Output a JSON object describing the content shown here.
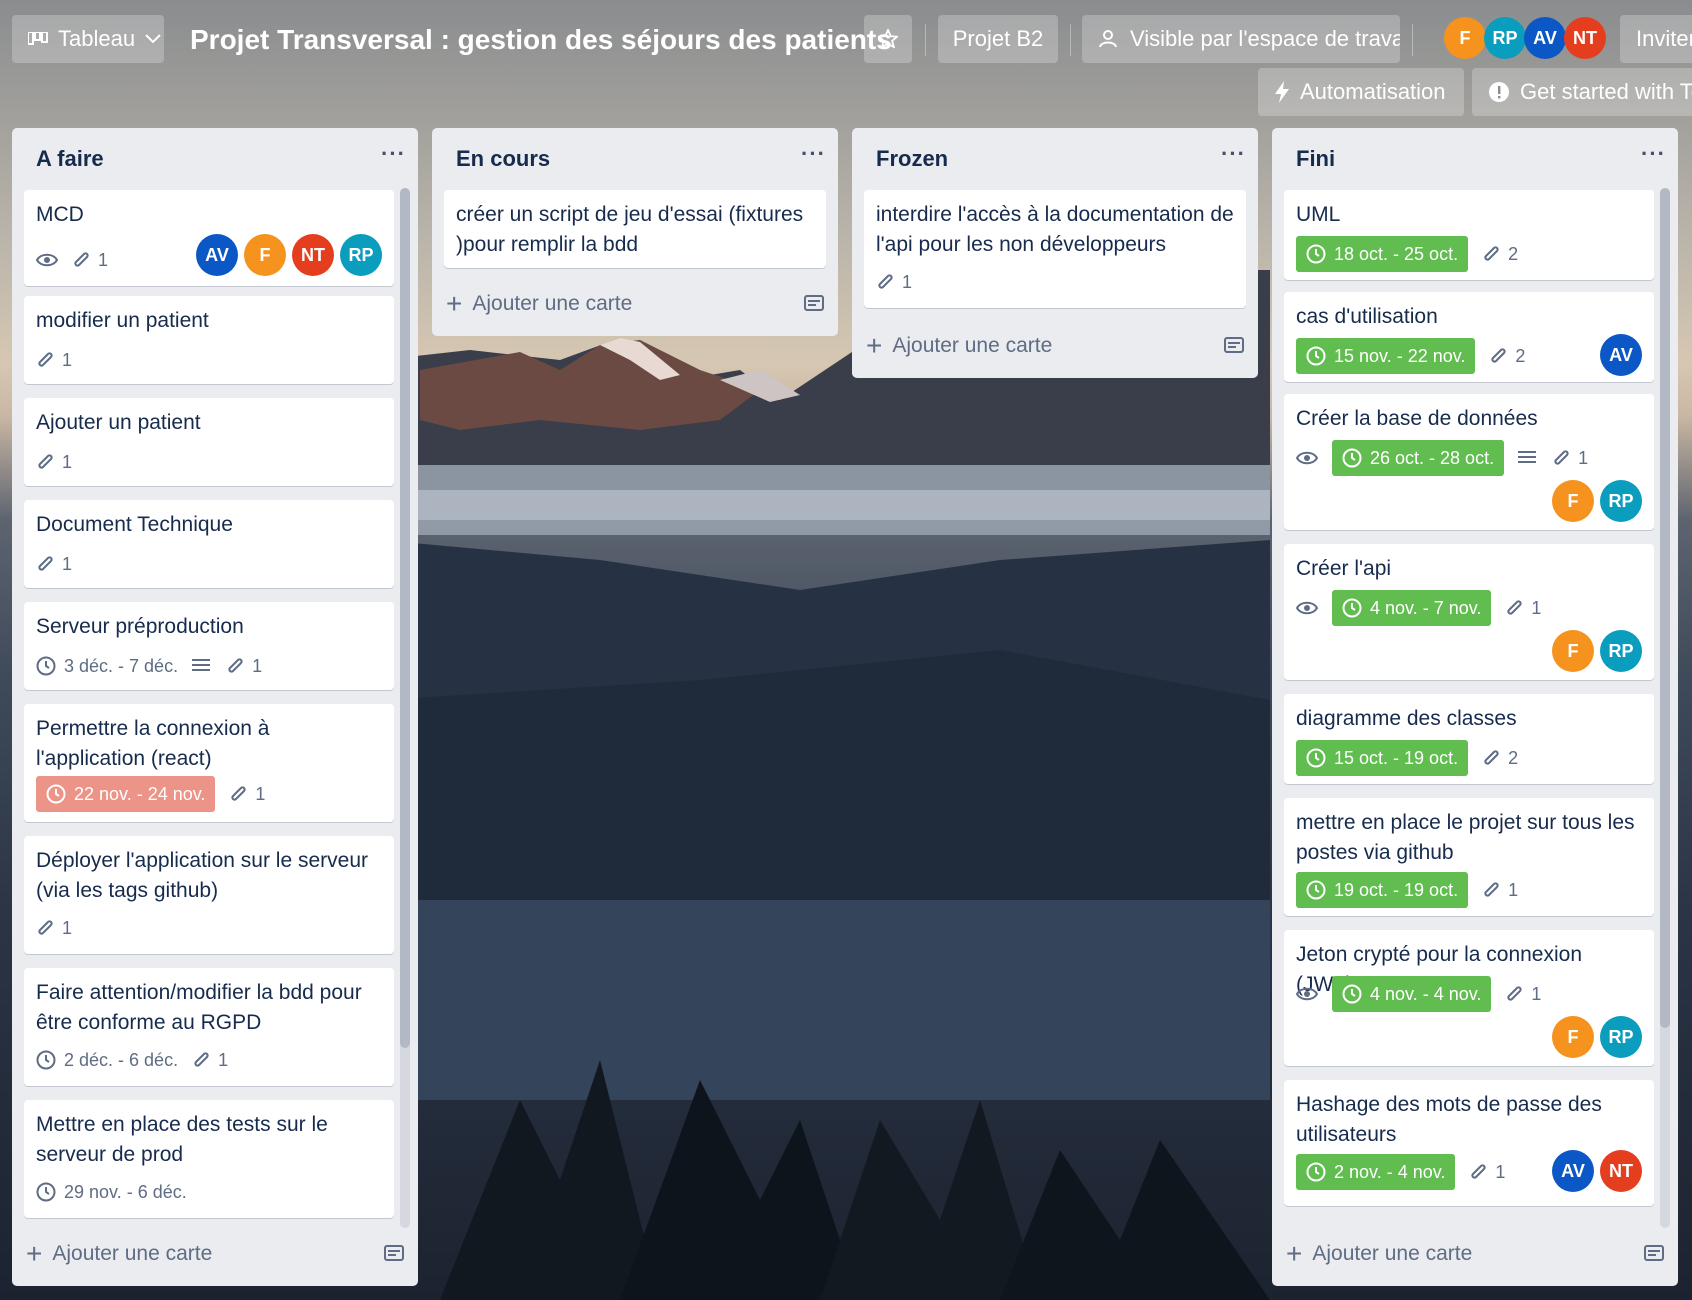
{
  "header": {
    "view_label": "Tableau",
    "board_title": "Projet Transversal : gestion des séjours des patients",
    "workspace_label": "Projet B2",
    "visibility_label": "Visible par l'espace de travail",
    "invite_label": "Inviter",
    "automation_label": "Automatisation",
    "get_started_label": "Get started with Te",
    "members": [
      {
        "initials": "F",
        "color": "#f6921e"
      },
      {
        "initials": "RP",
        "color": "#0b9dbd"
      },
      {
        "initials": "AV",
        "color": "#0c57c6"
      },
      {
        "initials": "NT",
        "color": "#e53e1f"
      }
    ]
  },
  "colors": {
    "AV": "#0c57c6",
    "F": "#f6921e",
    "NT": "#e53e1f",
    "RP": "#0b9dbd",
    "date_done": "#61bd4f",
    "date_overdue": "#ec9488"
  },
  "add_card_label": "Ajouter une carte",
  "lists": [
    {
      "title": "A faire",
      "cards": [
        {
          "title": "MCD",
          "watch": true,
          "attachments": "1",
          "members": [
            "AV",
            "F",
            "NT",
            "RP"
          ]
        },
        {
          "title": "modifier un patient",
          "attachments": "1"
        },
        {
          "title": "Ajouter un patient",
          "attachments": "1"
        },
        {
          "title": "Document Technique",
          "attachments": "1"
        },
        {
          "title": "Serveur préproduction",
          "date": "3 déc. - 7 déc.",
          "date_style": "plain",
          "description": true,
          "attachments": "1"
        },
        {
          "title": "Permettre la connexion à l'application (react)",
          "date": "22 nov. - 24 nov.",
          "date_style": "overdue",
          "attachments": "1"
        },
        {
          "title": "Déployer l'application sur le serveur (via les tags github)",
          "attachments": "1"
        },
        {
          "title": "Faire attention/modifier la bdd pour être conforme au RGPD",
          "date": "2 déc. - 6 déc.",
          "date_style": "plain",
          "attachments": "1"
        },
        {
          "title": "Mettre en place des tests sur le serveur de prod",
          "date": "29 nov. - 6 déc.",
          "date_style": "plain"
        }
      ]
    },
    {
      "title": "En cours",
      "cards": [
        {
          "title": "créer un script de jeu d'essai (fixtures )pour remplir la bdd"
        }
      ]
    },
    {
      "title": "Frozen",
      "cards": [
        {
          "title": "interdire l'accès à la documentation de l'api pour les non développeurs",
          "attachments": "1"
        }
      ]
    },
    {
      "title": "Fini",
      "cards": [
        {
          "title": "UML",
          "date": "18 oct. - 25 oct.",
          "date_style": "done",
          "attachments": "2"
        },
        {
          "title": "cas d'utilisation",
          "date": "15 nov. - 22 nov.",
          "date_style": "done",
          "attachments": "2",
          "members": [
            "AV"
          ]
        },
        {
          "title": "Créer la base de données",
          "watch": true,
          "date": "26 oct. - 28 oct.",
          "date_style": "done",
          "description": true,
          "attachments": "1",
          "members": [
            "F",
            "RP"
          ]
        },
        {
          "title": "Créer l'api",
          "watch": true,
          "date": "4 nov. - 7 nov.",
          "date_style": "done",
          "attachments": "1",
          "members": [
            "F",
            "RP"
          ]
        },
        {
          "title": "diagramme des classes",
          "date": "15 oct. - 19 oct.",
          "date_style": "done",
          "attachments": "2"
        },
        {
          "title": "mettre en place le projet sur tous les postes via github",
          "date": "19 oct. - 19 oct.",
          "date_style": "done",
          "attachments": "1"
        },
        {
          "title": "Jeton crypté pour la connexion (JWT)",
          "watch": true,
          "date": "4 nov. - 4 nov.",
          "date_style": "done",
          "attachments": "1",
          "members": [
            "F",
            "RP"
          ]
        },
        {
          "title": "Hashage des mots de passe des utilisateurs",
          "date": "2 nov. - 4 nov.",
          "date_style": "done",
          "attachments": "1",
          "members": [
            "AV",
            "NT"
          ]
        }
      ]
    }
  ]
}
